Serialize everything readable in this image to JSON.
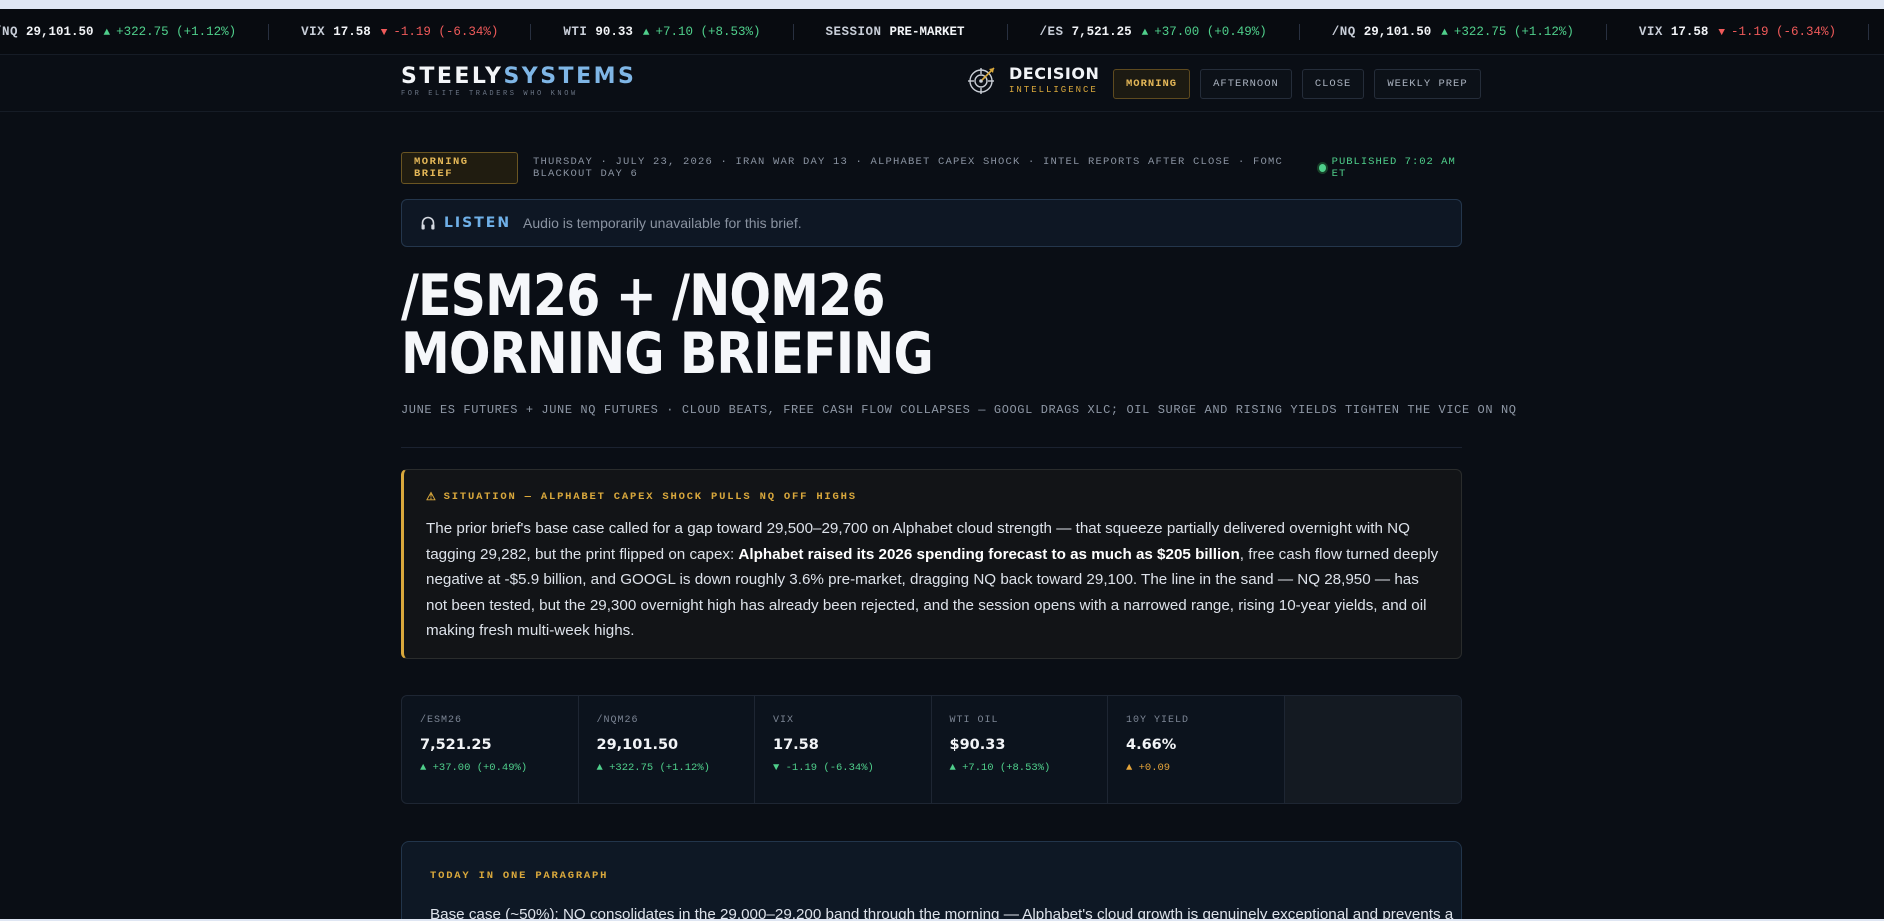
{
  "ticker": [
    {
      "symbol": "/NQ",
      "value": "29,101.50",
      "change": "+322.75 (+1.12%)",
      "dir": "up"
    },
    {
      "symbol": "VIX",
      "value": "17.58",
      "change": "-1.19 (-6.34%)",
      "dir": "down"
    },
    {
      "symbol": "WTI",
      "value": "90.33",
      "change": "+7.10 (+8.53%)",
      "dir": "up"
    },
    {
      "symbol": "SESSION",
      "value": "PRE-MARKET",
      "change": "",
      "dir": "none"
    },
    {
      "symbol": "/ES",
      "value": "7,521.25",
      "change": "+37.00 (+0.49%)",
      "dir": "up"
    },
    {
      "symbol": "/NQ",
      "value": "29,101.50",
      "change": "+322.75 (+1.12%)",
      "dir": "up"
    },
    {
      "symbol": "VIX",
      "value": "17.58",
      "change": "-1.19 (-6.34%)",
      "dir": "down"
    }
  ],
  "header": {
    "logo_a": "STEELY",
    "logo_b": "SYSTEMS",
    "logo_sub": "FOR ELITE TRADERS WHO KNOW",
    "di_title": "DECISION",
    "di_sub": "INTELLIGENCE",
    "tabs": [
      "MORNING",
      "AFTERNOON",
      "CLOSE",
      "WEEKLY PREP"
    ],
    "active_tab": "MORNING"
  },
  "brief": {
    "badge": "MORNING BRIEF",
    "meta": "THURSDAY · JULY 23, 2026 · IRAN WAR DAY 13 · ALPHABET CAPEX SHOCK · INTEL REPORTS AFTER CLOSE · FOMC BLACKOUT DAY 6",
    "published": "PUBLISHED 7:02 AM ET"
  },
  "listen": {
    "label": "LISTEN",
    "text": "Audio is temporarily unavailable for this brief."
  },
  "title_line1": "/ESM26 + /NQM26",
  "title_line2": "MORNING BRIEFING",
  "subtitle": "JUNE ES FUTURES + JUNE NQ FUTURES · CLOUD BEATS, FREE CASH FLOW COLLAPSES — GOOGL DRAGS XLC; OIL SURGE AND RISING YIELDS TIGHTEN THE VICE ON NQ",
  "situation": {
    "heading": "SITUATION — ALPHABET CAPEX SHOCK PULLS NQ OFF HIGHS",
    "body_before": "The prior brief's base case called for a gap toward 29,500–29,700 on Alphabet cloud strength — that squeeze partially delivered overnight with NQ tagging 29,282, but the print flipped on capex: ",
    "body_bold": "Alphabet raised its 2026 spending forecast to as much as $205 billion",
    "body_after": ", free cash flow turned deeply negative at -$5.9 billion, and GOOGL is down roughly 3.6% pre-market, dragging NQ back toward 29,100. The line in the sand — NQ 28,950 — has not been tested, but the 29,300 overnight high has already been rejected, and the session opens with a narrowed range, rising 10-year yields, and oil making fresh multi-week highs."
  },
  "metrics": [
    {
      "label": "/ESM26",
      "value": "7,521.25",
      "change": "▲ +37.00 (+0.49%)",
      "tone": "up"
    },
    {
      "label": "/NQM26",
      "value": "29,101.50",
      "change": "▲ +322.75 (+1.12%)",
      "tone": "up"
    },
    {
      "label": "VIX",
      "value": "17.58",
      "change": "▼ -1.19 (-6.34%)",
      "tone": "down"
    },
    {
      "label": "WTI OIL",
      "value": "$90.33",
      "change": "▲ +7.10 (+8.53%)",
      "tone": "up"
    },
    {
      "label": "10Y YIELD",
      "value": "4.66%",
      "change": "▲ +0.09",
      "tone": "amber"
    }
  ],
  "today": {
    "heading": "TODAY IN ONE PARAGRAPH",
    "body": "Base case (~50%): NQ consolidates in the 29,000–29,200 band through the morning — Alphabet's cloud growth is genuinely exceptional and prevents a"
  },
  "colors": {
    "accent_gold": "#d9a83c",
    "accent_blue": "#6fb0e8",
    "up_green": "#4fcf8b",
    "down_red": "#ef5a5a"
  }
}
